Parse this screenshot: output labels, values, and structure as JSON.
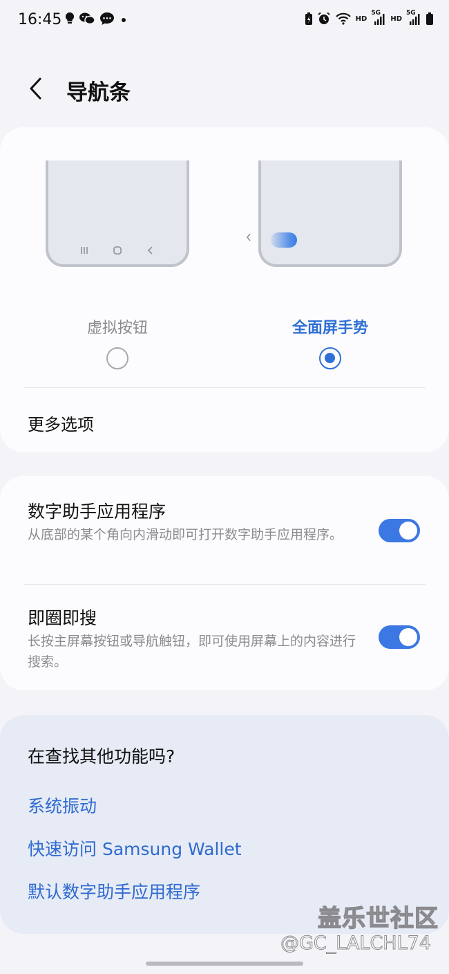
{
  "status_bar": {
    "time": "16:45",
    "hd_1": "HD",
    "hd_2": "HD",
    "signal_5g_1": "5G",
    "signal_5g_2": "5G",
    "left_icons": [
      "lightbulb-icon",
      "wechat-icon",
      "message-icon",
      "dot-icon"
    ],
    "right_icons": [
      "battery-saver-icon",
      "alarm-icon",
      "wifi-icon",
      "signal-icon",
      "signal-icon",
      "battery-icon"
    ]
  },
  "header": {
    "title": "导航条"
  },
  "nav_type": {
    "options": [
      {
        "label": "虚拟按钮",
        "selected": false
      },
      {
        "label": "全面屏手势",
        "selected": true
      }
    ],
    "more_options": "更多选项"
  },
  "toggles": [
    {
      "title": "数字助手应用程序",
      "description": "从底部的某个角向内滑动即可打开数字助手应用程序。",
      "enabled": true
    },
    {
      "title": "即圈即搜",
      "description": "长按主屏幕按钮或导航触钮，即可使用屏幕上的内容进行搜索。",
      "enabled": true
    }
  ],
  "find_more": {
    "title": "在查找其他功能吗?",
    "links": [
      "系统振动",
      "快速访问 Samsung Wallet",
      "默认数字助手应用程序"
    ]
  },
  "watermark": {
    "brand": "盖乐世社区",
    "user": "@GC_LALCHL74"
  },
  "colors": {
    "accent": "#2f6fd6",
    "toggle_on": "#3c78e4",
    "link": "#2f6ad0",
    "background": "#f4f4f8",
    "card": "#fcfcfe",
    "find_card": "#e6ebf5"
  }
}
